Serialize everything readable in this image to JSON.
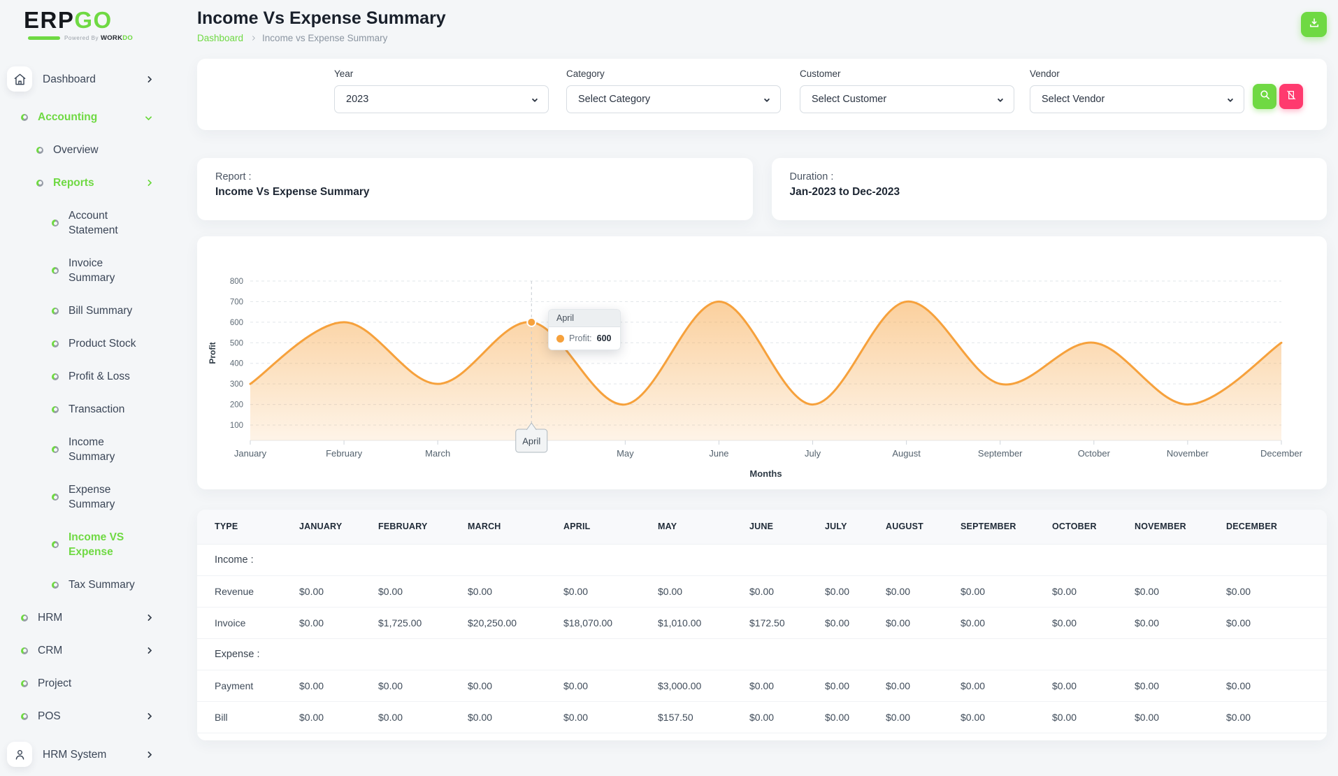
{
  "brand": {
    "erp": "ERP",
    "go": "GO",
    "powered": "Powered By",
    "work": "WORK",
    "do": "DO"
  },
  "colors": {
    "accent_green": "#6fd943",
    "danger_pink": "#ff3a6e",
    "chart_orange": "#f6a13c"
  },
  "icons": {
    "logo_home": "home-icon",
    "user": "user-icon",
    "bullet": "bullet-icon",
    "chevron_right": "chevron-right-icon",
    "chevron_down": "chevron-down-icon",
    "download": "download-icon",
    "search": "search-icon",
    "clear_filter": "clear-filter-icon"
  },
  "sidebar": {
    "items": [
      {
        "label": "Dashboard",
        "level": 0,
        "icon": "home",
        "chevron": "right",
        "active": false,
        "wrap": false
      },
      {
        "label": "Accounting",
        "level": 1,
        "icon": "dot",
        "chevron": "down",
        "active": true,
        "wrap": false
      },
      {
        "label": "Overview",
        "level": 2,
        "icon": "dot",
        "chevron": null,
        "active": false,
        "wrap": false
      },
      {
        "label": "Reports",
        "level": 2,
        "icon": "dot",
        "chevron": "right",
        "active": true,
        "wrap": false
      },
      {
        "label": "Account Statement",
        "level": 3,
        "icon": "dot",
        "chevron": null,
        "active": false,
        "wrap": true
      },
      {
        "label": "Invoice Summary",
        "level": 3,
        "icon": "dot",
        "chevron": null,
        "active": false,
        "wrap": false
      },
      {
        "label": "Bill Summary",
        "level": 3,
        "icon": "dot",
        "chevron": null,
        "active": false,
        "wrap": false
      },
      {
        "label": "Product Stock",
        "level": 3,
        "icon": "dot",
        "chevron": null,
        "active": false,
        "wrap": false
      },
      {
        "label": "Profit & Loss",
        "level": 3,
        "icon": "dot",
        "chevron": null,
        "active": false,
        "wrap": false
      },
      {
        "label": "Transaction",
        "level": 3,
        "icon": "dot",
        "chevron": null,
        "active": false,
        "wrap": false
      },
      {
        "label": "Income Summary",
        "level": 3,
        "icon": "dot",
        "chevron": null,
        "active": false,
        "wrap": false
      },
      {
        "label": "Expense Summary",
        "level": 3,
        "icon": "dot",
        "chevron": null,
        "active": false,
        "wrap": true
      },
      {
        "label": "Income VS Expense",
        "level": 3,
        "icon": "dot",
        "chevron": null,
        "active": true,
        "wrap": true
      },
      {
        "label": "Tax Summary",
        "level": 3,
        "icon": "dot",
        "chevron": null,
        "active": false,
        "wrap": false
      },
      {
        "label": "HRM",
        "level": 1,
        "icon": "dot",
        "chevron": "right",
        "active": false,
        "wrap": false
      },
      {
        "label": "CRM",
        "level": 1,
        "icon": "dot",
        "chevron": "right",
        "active": false,
        "wrap": false
      },
      {
        "label": "Project",
        "level": 1,
        "icon": "dot",
        "chevron": null,
        "active": false,
        "wrap": false
      },
      {
        "label": "POS",
        "level": 1,
        "icon": "dot",
        "chevron": "right",
        "active": false,
        "wrap": false
      },
      {
        "label": "HRM System",
        "level": 0,
        "icon": "user",
        "chevron": "right",
        "active": false,
        "wrap": false
      }
    ]
  },
  "header": {
    "title": "Income Vs Expense Summary",
    "breadcrumb_home": "Dashboard",
    "breadcrumb_current": "Income vs Expense Summary"
  },
  "filters": {
    "year": {
      "label": "Year",
      "value": "2023"
    },
    "category": {
      "label": "Category",
      "value": "Select Category"
    },
    "customer": {
      "label": "Customer",
      "value": "Select Customer"
    },
    "vendor": {
      "label": "Vendor",
      "value": "Select Vendor"
    }
  },
  "report_card": {
    "label": "Report :",
    "value": "Income Vs Expense Summary"
  },
  "duration_card": {
    "label": "Duration :",
    "value": "Jan-2023 to Dec-2023"
  },
  "chart_data": {
    "type": "area",
    "x": [
      "January",
      "February",
      "March",
      "April",
      "May",
      "June",
      "July",
      "August",
      "September",
      "October",
      "November",
      "December"
    ],
    "series": [
      {
        "name": "Profit",
        "values": [
          300,
          600,
          300,
          600,
          200,
          700,
          200,
          700,
          300,
          500,
          200,
          500
        ]
      }
    ],
    "xlabel": "Months",
    "ylabel": "Profit",
    "ylim": [
      100,
      800
    ],
    "ytick_step": 100,
    "grid": true,
    "legend": "none",
    "highlight": {
      "index": 3,
      "month": "April",
      "value": 600
    }
  },
  "tooltip": {
    "title": "April",
    "series_label": "Profit:",
    "value": "600"
  },
  "table": {
    "columns": [
      "TYPE",
      "JANUARY",
      "FEBRUARY",
      "MARCH",
      "APRIL",
      "MAY",
      "JUNE",
      "JULY",
      "AUGUST",
      "SEPTEMBER",
      "OCTOBER",
      "NOVEMBER",
      "DECEMBER"
    ],
    "sections": [
      {
        "label": "Income :",
        "rows": [
          {
            "type": "Revenue",
            "values": [
              "$0.00",
              "$0.00",
              "$0.00",
              "$0.00",
              "$0.00",
              "$0.00",
              "$0.00",
              "$0.00",
              "$0.00",
              "$0.00",
              "$0.00",
              "$0.00"
            ]
          },
          {
            "type": "Invoice",
            "values": [
              "$0.00",
              "$1,725.00",
              "$20,250.00",
              "$18,070.00",
              "$1,010.00",
              "$172.50",
              "$0.00",
              "$0.00",
              "$0.00",
              "$0.00",
              "$0.00",
              "$0.00"
            ]
          }
        ]
      },
      {
        "label": "Expense :",
        "rows": [
          {
            "type": "Payment",
            "values": [
              "$0.00",
              "$0.00",
              "$0.00",
              "$0.00",
              "$3,000.00",
              "$0.00",
              "$0.00",
              "$0.00",
              "$0.00",
              "$0.00",
              "$0.00",
              "$0.00"
            ]
          },
          {
            "type": "Bill",
            "values": [
              "$0.00",
              "$0.00",
              "$0.00",
              "$0.00",
              "$157.50",
              "$0.00",
              "$0.00",
              "$0.00",
              "$0.00",
              "$0.00",
              "$0.00",
              "$0.00"
            ]
          }
        ]
      }
    ]
  }
}
